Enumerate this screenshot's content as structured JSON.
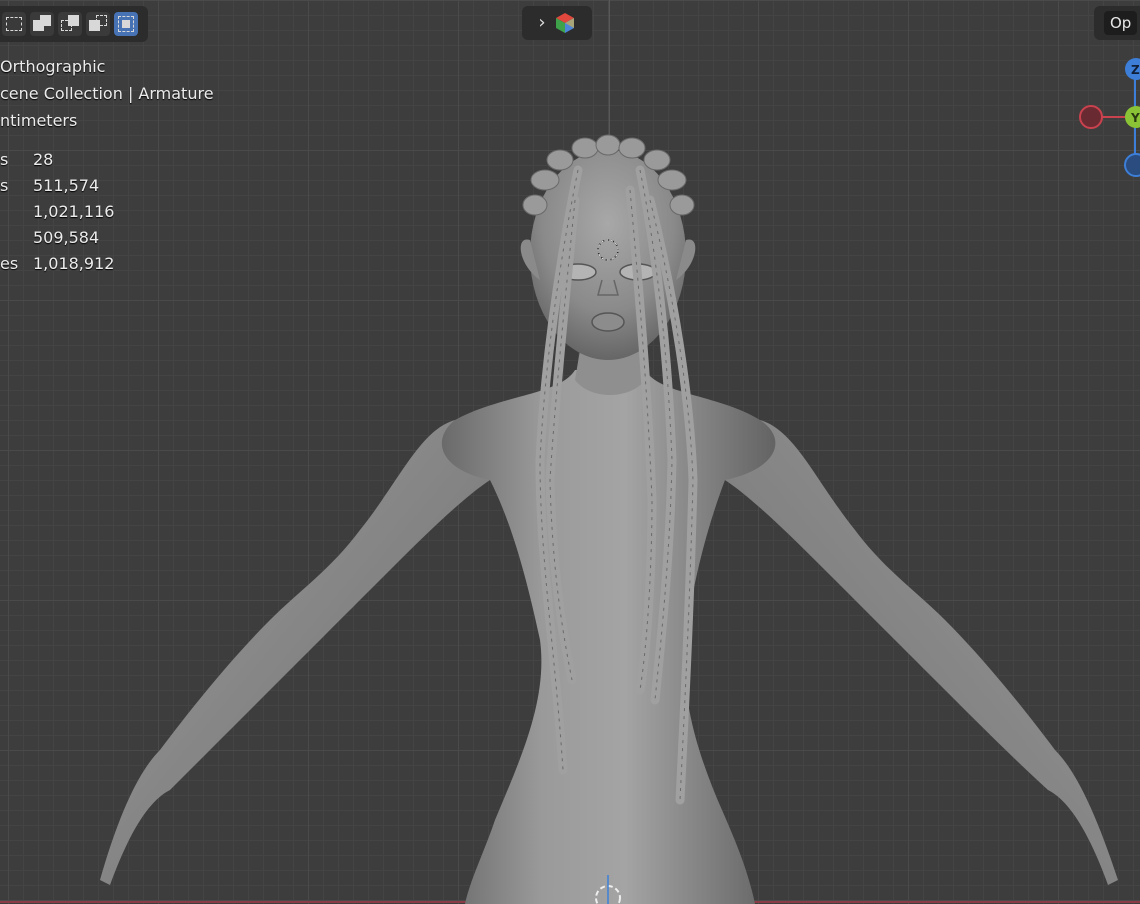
{
  "toolbar": {
    "select_modes": [
      "mode-new",
      "mode-extend",
      "mode-subtract",
      "mode-difference",
      "mode-intersect"
    ],
    "active_mode_index": 4,
    "options_label": "Op"
  },
  "overlay": {
    "view": "Orthographic",
    "collection": "cene Collection | Armature",
    "units": "ntimeters",
    "stats": [
      {
        "label": "s",
        "value": "28"
      },
      {
        "label": "s",
        "value": "511,574"
      },
      {
        "label": "",
        "value": "1,021,116"
      },
      {
        "label": "",
        "value": "509,584"
      },
      {
        "label": "es",
        "value": "1,018,912"
      }
    ]
  },
  "gizmo": {
    "z_label": "Z",
    "y_label": "Y",
    "colors": {
      "x": "#c9424e",
      "y": "#8ac436",
      "z": "#3d7fd8"
    }
  },
  "header_icon": "chevron-right-icon"
}
